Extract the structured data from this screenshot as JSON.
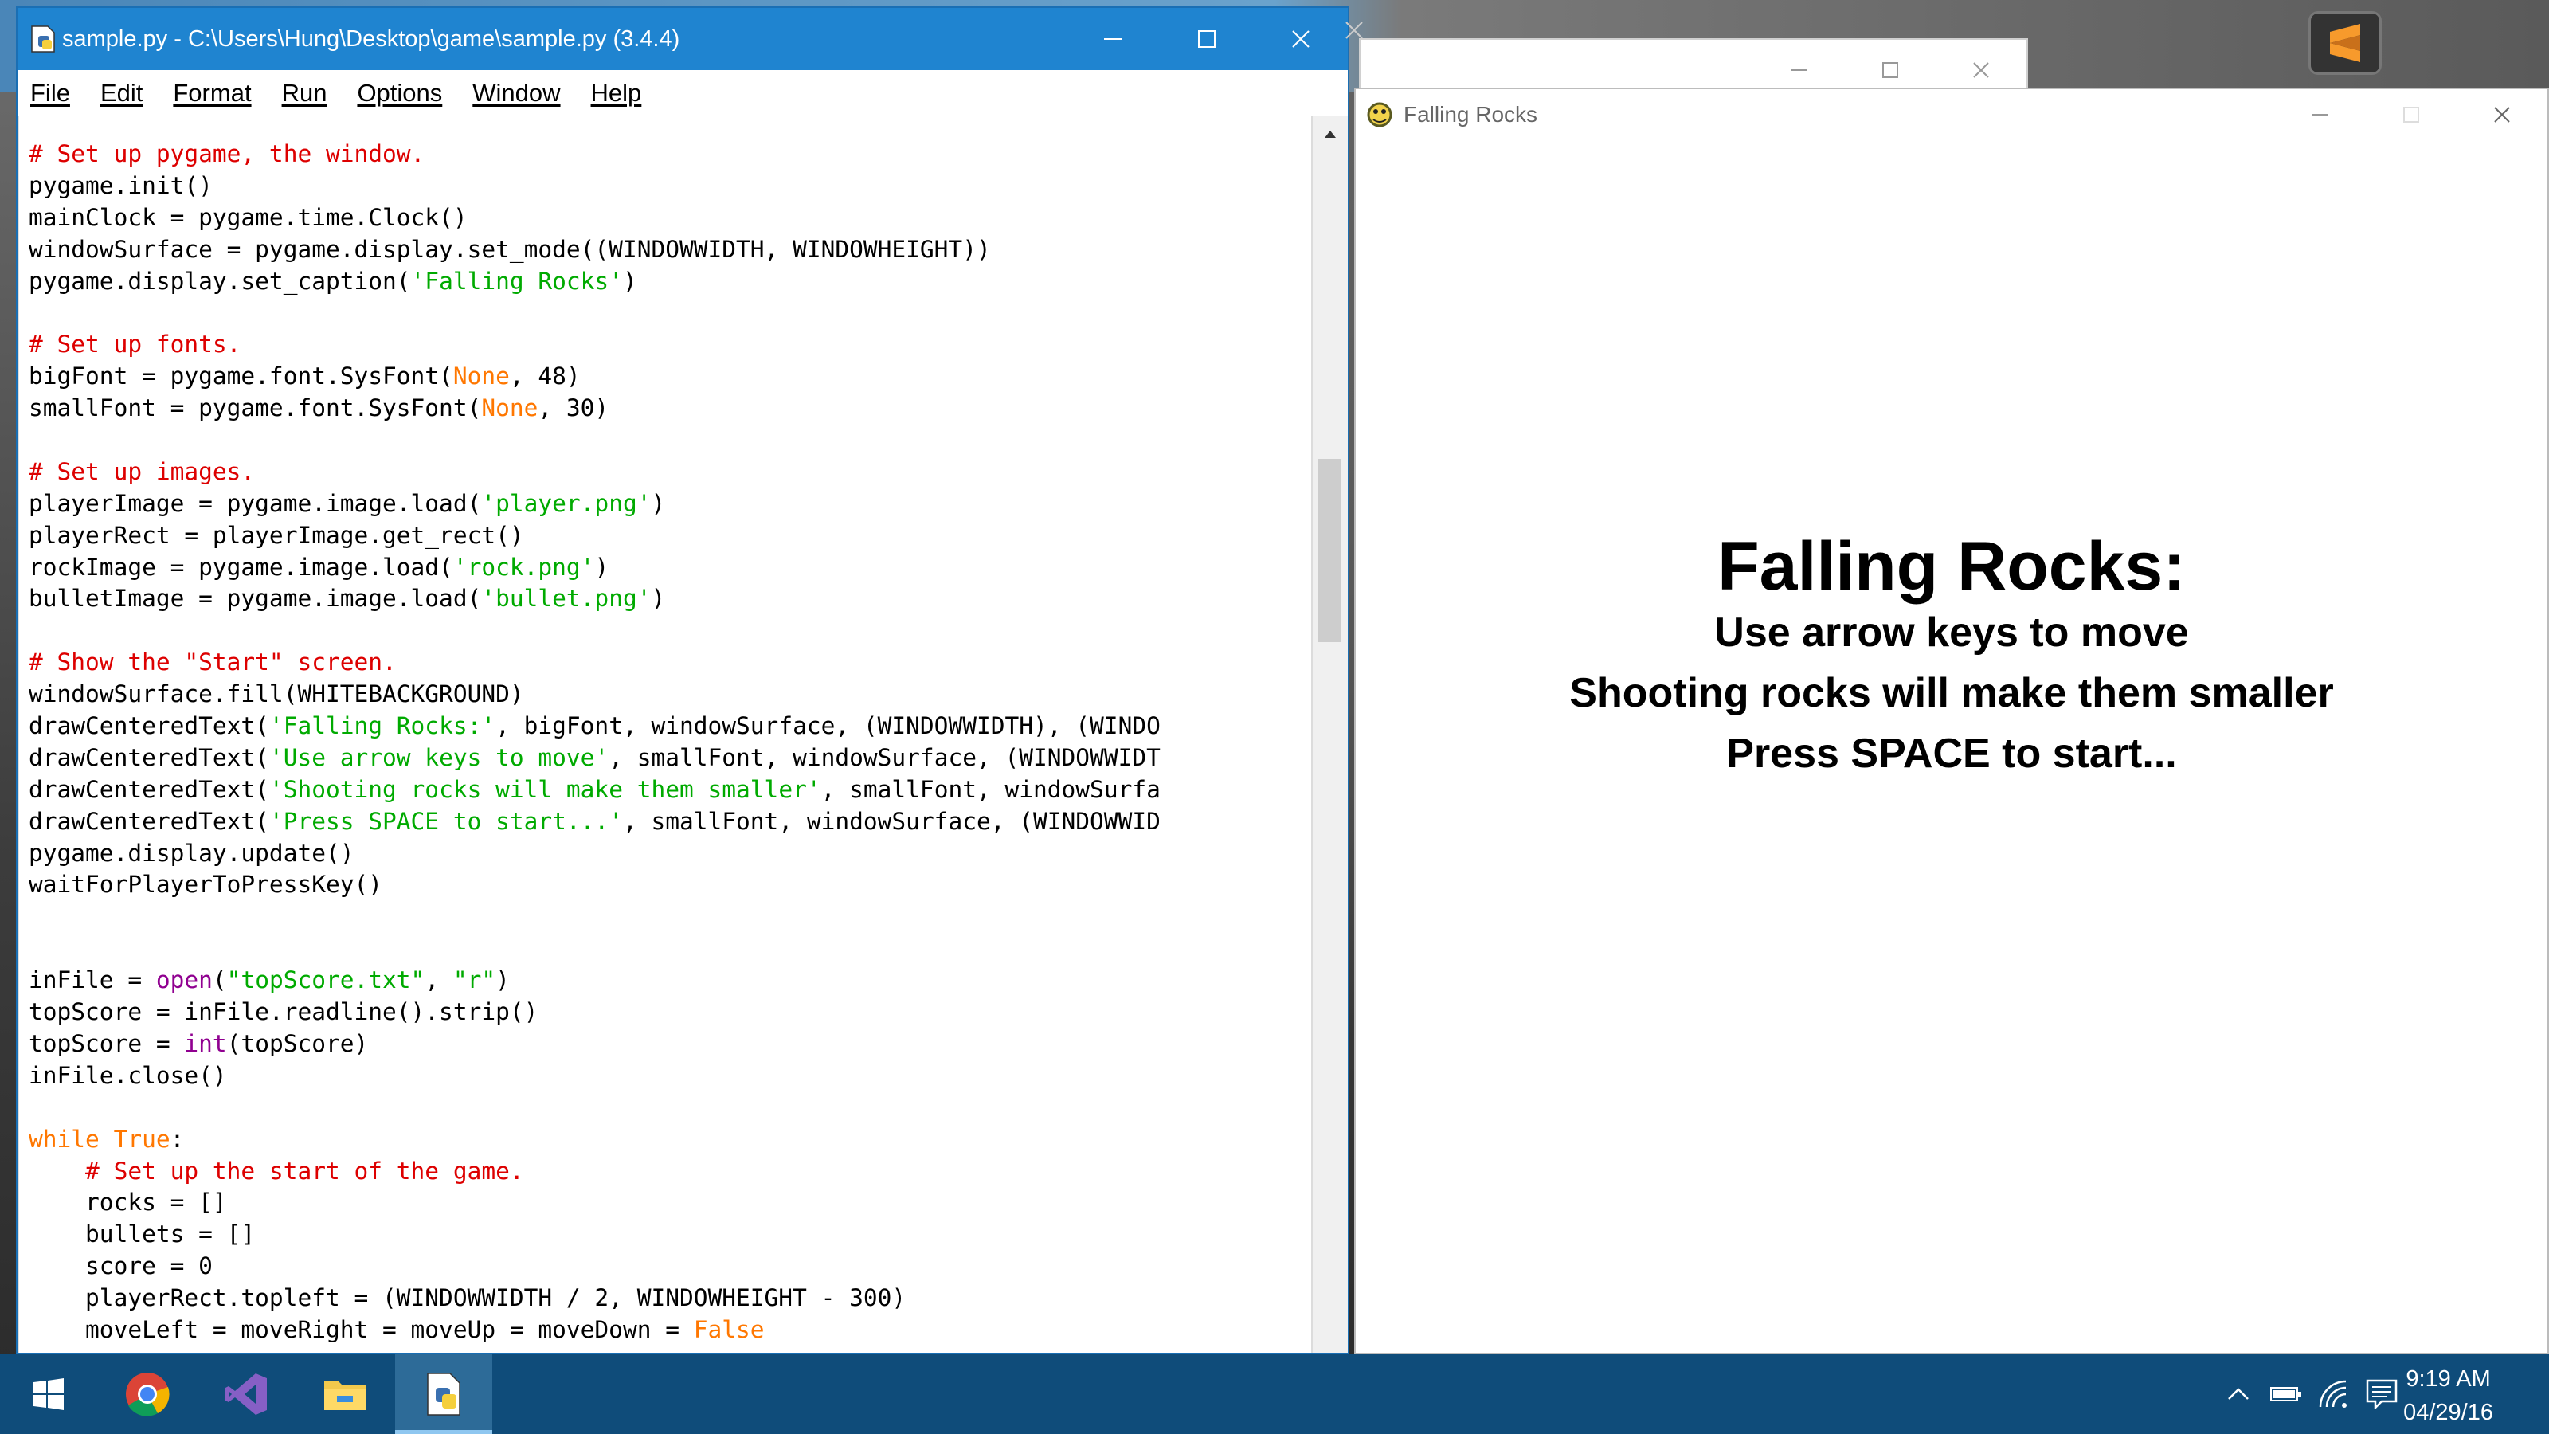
{
  "idle_window": {
    "title": "sample.py - C:\\Users\\Hung\\Desktop\\game\\sample.py (3.4.4)",
    "menu": [
      "File",
      "Edit",
      "Format",
      "Run",
      "Options",
      "Window",
      "Help"
    ],
    "code_lines": [
      [
        {
          "t": "# Set up pygame, the window.",
          "c": "com"
        }
      ],
      [
        {
          "t": "pygame.init()"
        }
      ],
      [
        {
          "t": "mainClock = pygame.time.Clock()"
        }
      ],
      [
        {
          "t": "windowSurface = pygame.display.set_mode((WINDOWWIDTH, WINDOWHEIGHT))"
        }
      ],
      [
        {
          "t": "pygame.display.set_caption("
        },
        {
          "t": "'Falling Rocks'",
          "c": "str"
        },
        {
          "t": ")"
        }
      ],
      [
        {
          "t": ""
        }
      ],
      [
        {
          "t": "# Set up fonts.",
          "c": "com"
        }
      ],
      [
        {
          "t": "bigFont = pygame.font.SysFont("
        },
        {
          "t": "None",
          "c": "kw"
        },
        {
          "t": ", 48)"
        }
      ],
      [
        {
          "t": "smallFont = pygame.font.SysFont("
        },
        {
          "t": "None",
          "c": "kw"
        },
        {
          "t": ", 30)"
        }
      ],
      [
        {
          "t": ""
        }
      ],
      [
        {
          "t": "# Set up images.",
          "c": "com"
        }
      ],
      [
        {
          "t": "playerImage = pygame.image.load("
        },
        {
          "t": "'player.png'",
          "c": "str"
        },
        {
          "t": ")"
        }
      ],
      [
        {
          "t": "playerRect = playerImage.get_rect()"
        }
      ],
      [
        {
          "t": "rockImage = pygame.image.load("
        },
        {
          "t": "'rock.png'",
          "c": "str"
        },
        {
          "t": ")"
        }
      ],
      [
        {
          "t": "bulletImage = pygame.image.load("
        },
        {
          "t": "'bullet.png'",
          "c": "str"
        },
        {
          "t": ")"
        }
      ],
      [
        {
          "t": ""
        }
      ],
      [
        {
          "t": "# Show the \"Start\" screen.",
          "c": "com"
        }
      ],
      [
        {
          "t": "windowSurface.fill(WHITEBACKGROUND)"
        }
      ],
      [
        {
          "t": "drawCenteredText("
        },
        {
          "t": "'Falling Rocks:'",
          "c": "str"
        },
        {
          "t": ", bigFont, windowSurface, (WINDOWWIDTH), (WINDO"
        }
      ],
      [
        {
          "t": "drawCenteredText("
        },
        {
          "t": "'Use arrow keys to move'",
          "c": "str"
        },
        {
          "t": ", smallFont, windowSurface, (WINDOWWIDT"
        }
      ],
      [
        {
          "t": "drawCenteredText("
        },
        {
          "t": "'Shooting rocks will make them smaller'",
          "c": "str"
        },
        {
          "t": ", smallFont, windowSurfa"
        }
      ],
      [
        {
          "t": "drawCenteredText("
        },
        {
          "t": "'Press SPACE to start...'",
          "c": "str"
        },
        {
          "t": ", smallFont, windowSurface, (WINDOWWID"
        }
      ],
      [
        {
          "t": "pygame.display.update()"
        }
      ],
      [
        {
          "t": "waitForPlayerToPressKey()"
        }
      ],
      [
        {
          "t": ""
        }
      ],
      [
        {
          "t": ""
        }
      ],
      [
        {
          "t": "inFile = "
        },
        {
          "t": "open",
          "c": "bi"
        },
        {
          "t": "("
        },
        {
          "t": "\"topScore.txt\"",
          "c": "str"
        },
        {
          "t": ", "
        },
        {
          "t": "\"r\"",
          "c": "str"
        },
        {
          "t": ")"
        }
      ],
      [
        {
          "t": "topScore = inFile.readline().strip()"
        }
      ],
      [
        {
          "t": "topScore = "
        },
        {
          "t": "int",
          "c": "bi"
        },
        {
          "t": "(topScore)"
        }
      ],
      [
        {
          "t": "inFile.close()"
        }
      ],
      [
        {
          "t": ""
        }
      ],
      [
        {
          "t": "while",
          "c": "kw"
        },
        {
          "t": " "
        },
        {
          "t": "True",
          "c": "kw"
        },
        {
          "t": ":"
        }
      ],
      [
        {
          "t": "    "
        },
        {
          "t": "# Set up the start of the game.",
          "c": "com"
        }
      ],
      [
        {
          "t": "    rocks = []"
        }
      ],
      [
        {
          "t": "    bullets = []"
        }
      ],
      [
        {
          "t": "    score = 0"
        }
      ],
      [
        {
          "t": "    playerRect.topleft = (WINDOWWIDTH / 2, WINDOWHEIGHT - 300)"
        }
      ],
      [
        {
          "t": "    moveLeft = moveRight = moveUp = moveDown = "
        },
        {
          "t": "False",
          "c": "kw"
        }
      ]
    ]
  },
  "game_window": {
    "title": "Falling Rocks",
    "heading": "Falling Rocks:",
    "line1": "Use arrow keys to move",
    "line2": "Shooting rocks will make them smaller",
    "line3": "Press SPACE to start..."
  },
  "taskbar": {
    "apps": [
      "windows-start-icon",
      "chrome-icon",
      "visual-studio-icon",
      "file-explorer-icon",
      "python-idle-icon"
    ],
    "active_app": "python-idle-icon",
    "tray_icons": [
      "chevron-up-icon",
      "battery-icon",
      "wifi-icon",
      "notifications-icon"
    ],
    "time": "9:19 AM",
    "date": "04/29/16"
  },
  "colors": {
    "idle_titlebar": "#1f84d0",
    "taskbar": "#0f4c7a",
    "comment": "#dd0000",
    "string": "#00aa00",
    "keyword": "#ff7700",
    "builtin": "#900090"
  }
}
